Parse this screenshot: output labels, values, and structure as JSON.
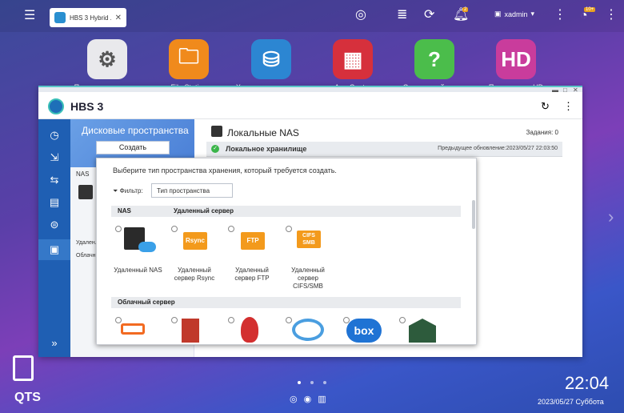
{
  "topbar": {
    "tab_label": "HBS 3 Hybrid ...",
    "user": "xadmin",
    "notif_badge": "2",
    "update_badge": "10+"
  },
  "apps": [
    {
      "label": "Панель управления",
      "color": "#e9e9ec",
      "icon": "gear-icon"
    },
    {
      "label": "File Station",
      "color": "#f08a1c",
      "icon": "folder-icon"
    },
    {
      "label": "Хранилище и снимки",
      "color": "#2c86d2",
      "icon": "storage-icon"
    },
    {
      "label": "App Center",
      "color": "#d6303c",
      "icon": "app-grid-icon"
    },
    {
      "label": "Справочный центр",
      "color": "#4bbd4b",
      "icon": "help-icon"
    },
    {
      "label": "Приложения HD",
      "color": "#c93c9c",
      "icon": "hd-icon"
    }
  ],
  "window": {
    "title": "HBS 3"
  },
  "panel": {
    "heading": "Дисковые пространства",
    "create": "Создать",
    "nas": "NAS",
    "remote": "Удален...",
    "cloud": "Облачн..."
  },
  "main": {
    "title": "Локальные NAS",
    "jobs": "Задания: 0",
    "storage": "Локальное хранилище",
    "updated": "Предыдущее обновление:2023/05/27 22:03:50"
  },
  "modal": {
    "prompt": "Выберите тип пространства хранения, который требуется создать.",
    "filter_label": "Фильтр:",
    "filter_value": "Тип пространства",
    "section_nas": "NAS",
    "section_remote": "Удаленный сервер",
    "section_cloud": "Облачный сервер",
    "opt_nas": "Удаленный NAS",
    "opt_rsync": "Удаленный сервер Rsync",
    "opt_ftp": "Удаленный сервер FTP",
    "opt_cifs": "Удаленный сервер CIFS/SMB",
    "rsync_icon": "Rsync",
    "ftp_icon": "FTP",
    "cifs_icon": "CIFS SMB",
    "box_icon": "box"
  },
  "bottom": {
    "time": "22:04",
    "date": "2023/05/27 Суббота",
    "brand": "QTS"
  }
}
